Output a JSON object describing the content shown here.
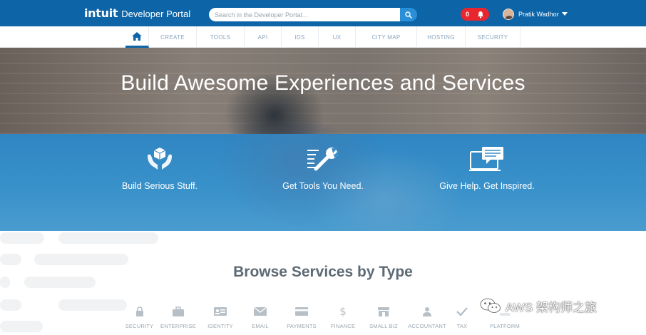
{
  "header": {
    "logo_brand": "intuit",
    "logo_text": "Developer Portal",
    "search_placeholder": "Search in the Developer Portal...",
    "notifications_count": "0",
    "user_name": "Pratik Wadhor",
    "brand_color": "#0d65a8",
    "alert_color": "#e8262d"
  },
  "nav": {
    "home_icon": "home-icon",
    "items": [
      "CREATE",
      "TOOLS",
      "API",
      "IDS",
      "UX",
      "CITY MAP",
      "HOSTING",
      "SECURITY"
    ]
  },
  "hero": {
    "title": "Build Awesome Experiences and Services"
  },
  "features": [
    {
      "label": "Build Serious Stuff.",
      "icon": "hands-box-icon"
    },
    {
      "label": "Get Tools You Need.",
      "icon": "wrench-icon"
    },
    {
      "label": "Give Help. Get Inspired.",
      "icon": "monitor-chat-icon"
    }
  ],
  "browse": {
    "title": "Browse Services by Type",
    "services": [
      {
        "label": "SECURITY",
        "icon": "lock-icon"
      },
      {
        "label": "ENTERPRISE",
        "icon": "briefcase-icon"
      },
      {
        "label": "IDENTITY",
        "icon": "id-card-icon"
      },
      {
        "label": "EMAIL",
        "icon": "envelope-icon"
      },
      {
        "label": "PAYMENTS",
        "icon": "credit-card-icon"
      },
      {
        "label": "FINANCE",
        "icon": "dollar-icon"
      },
      {
        "label": "SMALL BIZ",
        "icon": "storefront-icon"
      },
      {
        "label": "ACCOUNTANT",
        "icon": "person-icon"
      },
      {
        "label": "TAX",
        "icon": "checkmark-icon"
      },
      {
        "label": "PLATFORM",
        "icon": "platform-icon"
      }
    ]
  },
  "watermark": {
    "text": "AWS 架构师之旅"
  }
}
